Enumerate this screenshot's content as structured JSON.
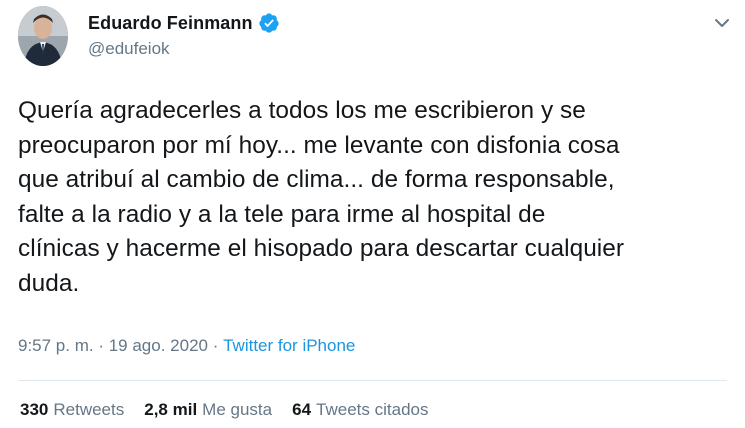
{
  "author": {
    "display_name": "Eduardo Feinmann",
    "handle": "@edufeiok",
    "verified": true
  },
  "tweet": {
    "lines": [
      "Quería agradecerles a todos los me escribieron y se",
      "preocuparon por mí hoy... me levante con disfonia cosa",
      "que atribuí al cambio de clima... de forma responsable,",
      "falte a la radio y a la tele para irme al hospital de",
      "clínicas y hacerme el hisopado para descartar cualquier",
      "duda."
    ]
  },
  "meta": {
    "time": "9:57 p. m.",
    "separator1": " · ",
    "date": "19 ago. 2020",
    "separator2": " · ",
    "source": "Twitter for iPhone"
  },
  "stats": {
    "retweets": {
      "count": "330",
      "label": "Retweets"
    },
    "likes": {
      "count": "2,8 mil",
      "label": "Me gusta"
    },
    "quotes": {
      "count": "64",
      "label": "Tweets citados"
    }
  },
  "icons": {
    "verified": "verified-badge-icon",
    "caret": "chevron-down-icon"
  },
  "colors": {
    "link": "#1b95e0",
    "secondary_text": "#657786",
    "verified": "#1da1f2"
  }
}
